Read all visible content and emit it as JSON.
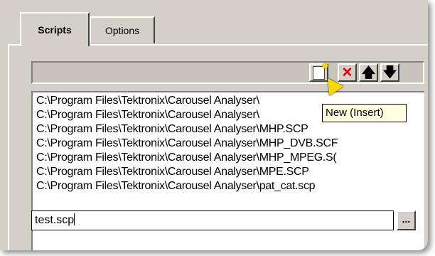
{
  "tabs": [
    {
      "label": "Scripts",
      "active": true
    },
    {
      "label": "Options",
      "active": false
    }
  ],
  "toolbar": {
    "new_icon": "new-document-icon",
    "delete_icon": "delete-x-icon",
    "up_icon": "arrow-up-icon",
    "down_icon": "arrow-down-icon",
    "delete_glyph": "✕",
    "up_glyph": "🡅",
    "down_glyph": "🡇"
  },
  "tooltip": {
    "text": "New (Insert)"
  },
  "list": {
    "items": [
      "C:\\Program Files\\Tektronix\\Carousel Analyser\\",
      "C:\\Program Files\\Tektronix\\Carousel Analyser\\",
      "C:\\Program Files\\Tektronix\\Carousel Analyser\\MHP.SCP",
      "C:\\Program Files\\Tektronix\\Carousel Analyser\\MHP_DVB.SCF",
      "C:\\Program Files\\Tektronix\\Carousel Analyser\\MHP_MPEG.S(",
      "C:\\Program Files\\Tektronix\\Carousel Analyser\\MPE.SCP",
      "C:\\Program Files\\Tektronix\\Carousel Analyser\\pat_cat.scp"
    ],
    "edit_value": "test.scp",
    "browse_label": "..."
  },
  "colors": {
    "window_bg": "#d4d0c8",
    "tooltip_bg": "#ffffe1",
    "delete_red": "#e00000"
  }
}
